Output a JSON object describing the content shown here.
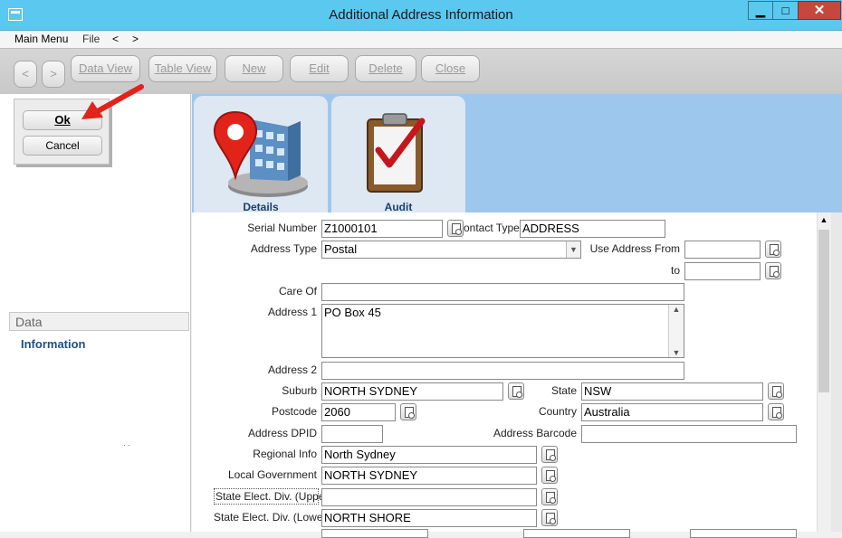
{
  "window": {
    "title": "Additional Address Information",
    "min_symbol": "▁",
    "max_symbol": "□",
    "close_symbol": "✕"
  },
  "menubar": {
    "main_menu": "Main Menu",
    "file": "File",
    "back": "<",
    "forward": ">"
  },
  "toolbar": {
    "prev": "<",
    "next": ">",
    "data_view": "Data View",
    "table_view": "Table View",
    "new": "New",
    "edit": "Edit",
    "delete": "Delete",
    "close": "Close"
  },
  "dialog": {
    "ok": "Ok",
    "cancel": "Cancel"
  },
  "sidebar": {
    "header": "Data",
    "item": "Information"
  },
  "tabs": [
    {
      "label": "Details",
      "active": true
    },
    {
      "label": "Audit",
      "active": false
    }
  ],
  "form": {
    "serial_number": {
      "label": "Serial Number",
      "value": "Z1000101"
    },
    "contact_type": {
      "label": "ontact Type",
      "value": "ADDRESS"
    },
    "address_type": {
      "label": "Address Type",
      "value": "Postal"
    },
    "use_address_from": {
      "label": "Use Address From",
      "value": ""
    },
    "to": {
      "label": "to",
      "value": ""
    },
    "care_of": {
      "label": "Care Of",
      "value": ""
    },
    "address_1": {
      "label": "Address 1",
      "value": "PO Box 45"
    },
    "address_2": {
      "label": "Address 2",
      "value": ""
    },
    "suburb": {
      "label": "Suburb",
      "value": "NORTH SYDNEY"
    },
    "state": {
      "label": "State",
      "value": "NSW"
    },
    "postcode": {
      "label": "Postcode",
      "value": "2060"
    },
    "country": {
      "label": "Country",
      "value": "Australia"
    },
    "address_dpid": {
      "label": "Address DPID",
      "value": ""
    },
    "address_barcode": {
      "label": "Address Barcode",
      "value": ""
    },
    "regional_info": {
      "label": "Regional Info",
      "value": "North Sydney"
    },
    "local_government": {
      "label": "Local Government",
      "value": "NORTH SYDNEY"
    },
    "state_elect_upper": {
      "label": "State Elect. Div. (Upper)",
      "value": ""
    },
    "state_elect_lower": {
      "label": "State Elect. Div. (Lower)",
      "value": "NORTH SHORE"
    }
  },
  "colors": {
    "titlebar": "#5bc8f0",
    "tabs_bg": "#9ec7ee",
    "link": "#1b4f8a",
    "arrow": "#e2231a"
  }
}
